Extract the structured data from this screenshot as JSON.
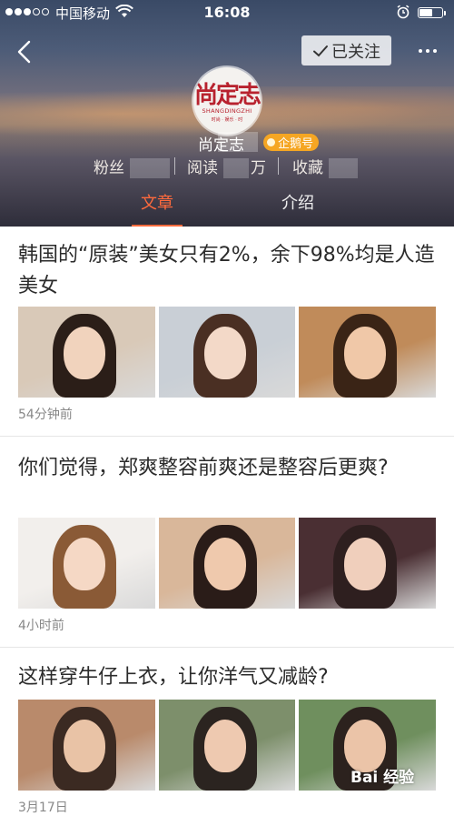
{
  "status_bar": {
    "carrier": "中国移动",
    "time": "16:08"
  },
  "header": {
    "follow_label": "已关注",
    "avatar": {
      "logo_text": "尚定志",
      "brand": "SHANGDINGZHI",
      "tagline": "时尚 · 娱乐 · 时"
    },
    "account_name": "尚定志",
    "badge_label": "企鹅号",
    "stats": {
      "fans_label": "粉丝",
      "reads_label": "阅读",
      "reads_suffix": "万",
      "favorites_label": "收藏"
    },
    "tabs": [
      {
        "label": "文章",
        "active": true
      },
      {
        "label": "介绍",
        "active": false
      }
    ]
  },
  "articles": [
    {
      "title": "韩国的“原装”美女只有2%，余下98%均是人造美女",
      "time": "54分钟前",
      "thumbnails": [
        {
          "bg": "#d9c9b8",
          "skin": "#f1d3bd",
          "hair": "#2b1e18"
        },
        {
          "bg": "#c9cfd6",
          "skin": "#f3d9c8",
          "hair": "#4a2f23"
        },
        {
          "bg": "#c08b5a",
          "skin": "#f0c8a8",
          "hair": "#3a2416"
        }
      ]
    },
    {
      "title": "你们觉得，郑爽整容前爽还是整容后更爽?",
      "time": "4小时前",
      "thumbnails": [
        {
          "bg": "#f2efec",
          "skin": "#f5d8c5",
          "hair": "#8a5a36"
        },
        {
          "bg": "#d9b79a",
          "skin": "#efc9ad",
          "hair": "#2a1c18"
        },
        {
          "bg": "#4a2f33",
          "skin": "#f0cfbc",
          "hair": "#2e1f1f"
        }
      ]
    },
    {
      "title": "这样穿牛仔上衣，让你洋气又减龄?",
      "time": "3月17日",
      "thumbnails": [
        {
          "bg": "#b98a6b",
          "skin": "#e9c3a6",
          "hair": "#3b2a22"
        },
        {
          "bg": "#7d8f6b",
          "skin": "#eec9b0",
          "hair": "#2b2420"
        },
        {
          "bg": "#6f8f5e",
          "skin": "#ebc4a8",
          "hair": "#2c221e"
        }
      ]
    }
  ],
  "watermark": "Bai 经验"
}
